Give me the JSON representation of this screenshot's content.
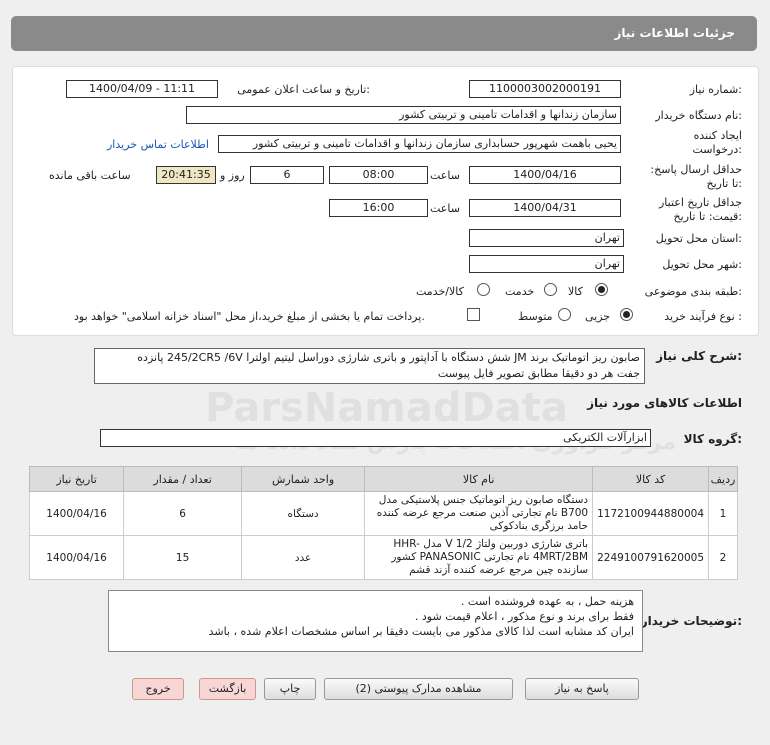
{
  "header": {
    "title": "جزئیات اطلاعات نیاز"
  },
  "fields": {
    "need_number_label": "شماره نیاز:",
    "need_number": "1100003002000191",
    "announce_label": "تاریخ و ساعت اعلان عمومی:",
    "announce_value": "1400/04/09 - 11:11",
    "buyer_org_label": "نام دستگاه خریدار:",
    "buyer_org": "سازمان زندانها و اقدامات تامینی و تربیتی کشور",
    "creator_label": "ایجاد کننده درخواست:",
    "creator": "یحیی باهمت شهرپور حسابداری سازمان زندانها و اقدامات تامینی و تربیتی کشور",
    "contact_link": "اطلاعات تماس خریدار",
    "deadline_label": "حداقل ارسال پاسخ: تا تاریخ:",
    "deadline_date": "1400/04/16",
    "time_label": "ساعت",
    "deadline_time": "08:00",
    "days_value": "6",
    "days_label": "روز و",
    "remaining_time": "20:41:35",
    "remaining_label": "ساعت باقی مانده",
    "validity_label": "جداقل تاریخ اعتبار قیمت: تا تاریخ:",
    "validity_date": "1400/04/31",
    "validity_time": "16:00",
    "province_label": "استان محل تحویل:",
    "province": "تهران",
    "city_label": "شهر محل تحویل:",
    "city": "تهران",
    "category_label": "طبقه بندی موضوعی:",
    "cat_goods": "کالا",
    "cat_service": "خدمت",
    "cat_goods_service": "کالا/خدمت",
    "process_label": "نوع فرآیند خرید :",
    "proc_partial": "جزیی",
    "proc_medium": "متوسط",
    "payment_note": "پرداخت تمام یا بخشی از مبلغ خرید،از محل \"اسناد خزانه اسلامی\" خواهد بود."
  },
  "description": {
    "label": "شرح کلی نیاز:",
    "text_line1": "صابون ریز اتوماتیک برند JM   شش دستگاه با آداپتور و باتری شارژی دوراسل لیتیم اولترا 245/2CR5 /6V پانزده",
    "text_line2": "جفت  هر دو دقیقا مطابق تصویر فایل پیوست"
  },
  "goods_info": {
    "title": "اطلاعات کالاهای مورد نیاز"
  },
  "group": {
    "label": "گروه کالا:",
    "value": "ابزارآلات الکتریکی"
  },
  "table": {
    "headers": [
      "ردیف",
      "کد کالا",
      "نام کالا",
      "واحد شمارش",
      "تعداد / مقدار",
      "تاریخ نیاز"
    ],
    "rows": [
      {
        "idx": "1",
        "code": "1172100944880004",
        "name": "دستگاه صابون ریز اتوماتیک جنس پلاستیکی مدل B700 نام تجارتی آذین صنعت مرجع عرضه کننده حامد برزگری بنادکوکی",
        "unit": "دستگاه",
        "qty": "6",
        "date": "1400/04/16"
      },
      {
        "idx": "2",
        "code": "2249100791620005",
        "name": "باتری شارژی دوربین ولتاژ V 1/2 مدل HHR-4MRT/2BM نام تجارتی PANASONIC کشور سازنده چین مرجع عرضه کننده آزند قشم",
        "unit": "عدد",
        "qty": "15",
        "date": "1400/04/16"
      }
    ]
  },
  "notes": {
    "label": "توضیحات خریدار:",
    "line1": "هزینه حمل ، به عهده فروشنده است .",
    "line2": "فقط برای برند  و نوع مذکور ، اعلام قیمت شود .",
    "line3": "ایران کد مشابه  است لذا کالای مذکور می بایست دقیقا بر اساس مشخصات اعلام شده ، باشد"
  },
  "buttons": {
    "reply": "پاسخ به نیاز",
    "attachments": "مشاهده مدارک پیوستی (2)",
    "print": "چاپ",
    "back": "بازگشت",
    "exit": "خروج"
  },
  "watermark": {
    "main": "ParsNamadData",
    "sub": "مرکز فراوری اطلاعات پارس نماد داده ها",
    "phone": "021-88349670"
  }
}
